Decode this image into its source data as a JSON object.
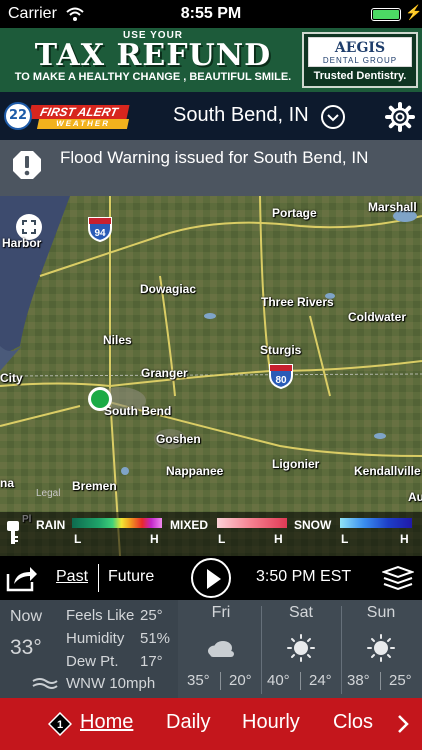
{
  "status_bar": {
    "carrier": "Carrier",
    "time": "8:55 PM"
  },
  "ad": {
    "top_line": "USE YOUR",
    "headline": "TAX REFUND",
    "tagline": "TO MAKE A HEALTHY CHANGE , BEAUTIFUL SMILE.",
    "brand": "AEGIS",
    "brand_sub": "DENTAL GROUP",
    "trusted": "Trusted Dentistry."
  },
  "header": {
    "logo_number": "22",
    "logo_line1": "FIRST ALERT",
    "logo_line2": "WEATHER",
    "location": "South Bend, IN"
  },
  "alert": {
    "text": "Flood Warning issued for South Bend, IN"
  },
  "map": {
    "cities": {
      "portage": "Portage",
      "marshall": "Marshall",
      "harbor": "Harbor",
      "dowagiac": "Dowagiac",
      "three_rivers": "Three Rivers",
      "coldwater": "Coldwater",
      "niles": "Niles",
      "sturgis": "Sturgis",
      "city": "City",
      "granger": "Granger",
      "south_bend": "South Bend",
      "goshen": "Goshen",
      "nappanee": "Nappanee",
      "ligonier": "Ligonier",
      "kendallville": "Kendallville",
      "bremen": "Bremen",
      "na": "na",
      "au": "Au",
      "pl": "Pl"
    },
    "highways": {
      "i94": "94",
      "i80": "80"
    },
    "legal": "Legal"
  },
  "legend": {
    "rain": "RAIN",
    "mixed": "MIXED",
    "snow": "SNOW",
    "low": "L",
    "high": "H"
  },
  "controls": {
    "past": "Past",
    "future": "Future",
    "time": "3:50 PM EST"
  },
  "current": {
    "now_label": "Now",
    "temp": "33°",
    "feels_like_label": "Feels Like",
    "feels_like": "25°",
    "humidity_label": "Humidity",
    "humidity": "51%",
    "dew_point_label": "Dew Pt.",
    "dew_point": "17°",
    "wind": "WNW 10mph"
  },
  "forecast": [
    {
      "day": "Fri",
      "icon": "cloudy-icon",
      "hi": "35°",
      "lo": "20°"
    },
    {
      "day": "Sat",
      "icon": "sunny-icon",
      "hi": "40°",
      "lo": "24°"
    },
    {
      "day": "Sun",
      "icon": "sunny-icon",
      "hi": "38°",
      "lo": "25°"
    }
  ],
  "nav": {
    "home": "Home",
    "daily": "Daily",
    "hourly": "Hourly",
    "closings": "Clos"
  },
  "colors": {
    "header_bg": "#0d1a2d",
    "alert_bg": "#4c5560",
    "conditions_bg": "#404a53",
    "nav_bg": "#c4161c",
    "location_pin": "#1bab46"
  }
}
